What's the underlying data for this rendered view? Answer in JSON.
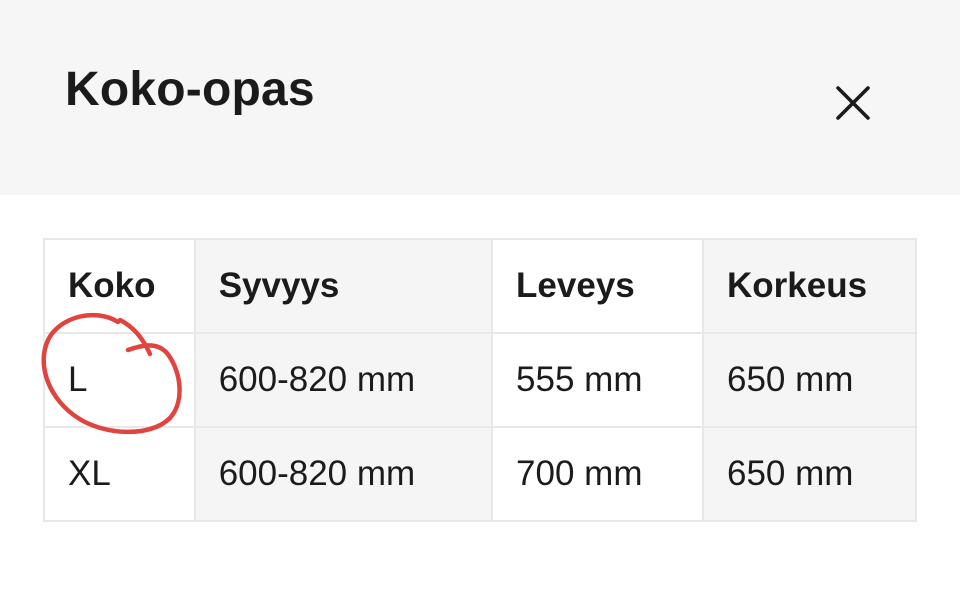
{
  "dialog": {
    "title": "Koko-opas"
  },
  "table": {
    "headers": [
      "Koko",
      "Syvyys",
      "Leveys",
      "Korkeus"
    ],
    "rows": [
      [
        "L",
        "600-820 mm",
        "555 mm",
        "650 mm"
      ],
      [
        "XL",
        "600-820 mm",
        "700 mm",
        "650 mm"
      ]
    ]
  },
  "colors": {
    "header_background": "#f6f6f6",
    "annotation_stroke": "#e0443f"
  }
}
